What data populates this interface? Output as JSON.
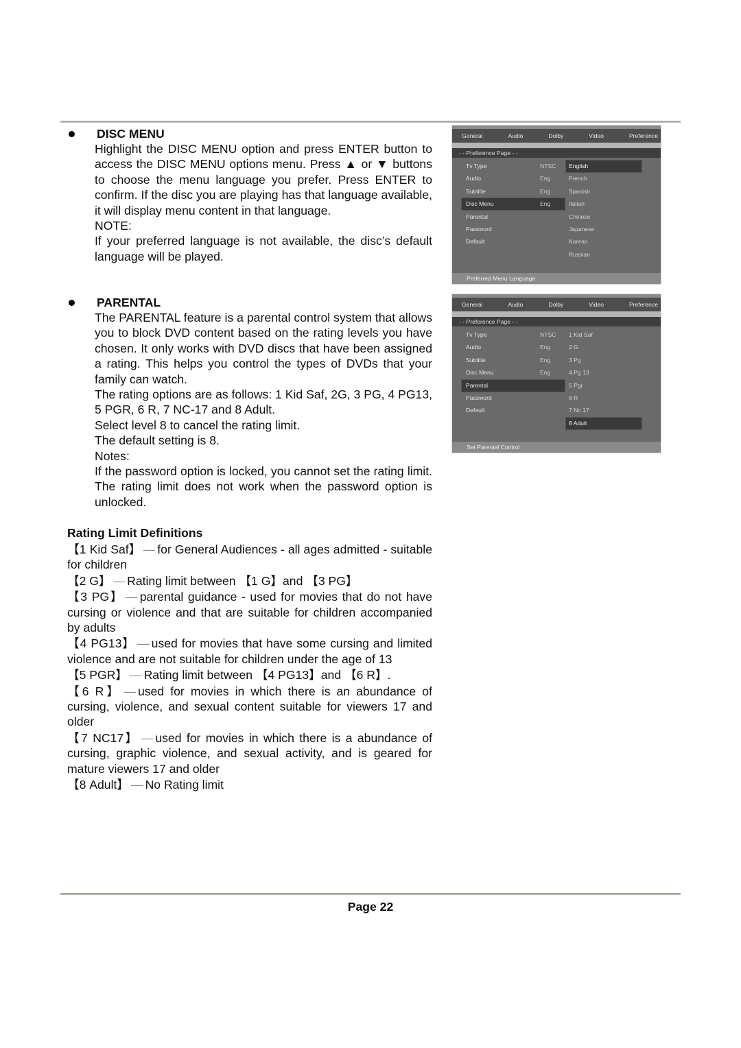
{
  "disc_menu": {
    "heading": "DISC MENU",
    "paragraph": "Highlight the DISC MENU option and press ENTER button to access the DISC MENU options menu. Press ▲ or ▼ buttons to choose the menu language you prefer. Press ENTER to confirm. If the disc you are playing has that language available, it will display menu content in that language.",
    "note_label": "NOTE:",
    "note": "If your preferred language is not available, the disc’s default language will be played."
  },
  "parental": {
    "heading": "PARENTAL",
    "paragraph": "The PARENTAL feature is a parental control system that allows you to block DVD content based on the rating levels you have chosen. It only works with DVD discs that have been assigned a rating. This helps you control the types of DVDs that your family can watch.",
    "options_text": "The rating options are as follows: 1 Kid Saf, 2G, 3 PG, 4 PG13, 5 PGR, 6 R, 7 NC-17 and 8 Adult.",
    "cancel_text": "Select level 8 to cancel the rating limit.",
    "default_text": "The default setting is 8.",
    "notes_label": "Notes:",
    "notes": "If the password option is locked, you cannot set the rating limit. The rating limit does not work when the password option is unlocked."
  },
  "rating_definitions": {
    "heading": "Rating Limit Definitions",
    "items": [
      {
        "tag": "【1 Kid Saf】",
        "text": "for General Audiences - all ages admitted - suitable for children"
      },
      {
        "tag": "【2 G】",
        "text": "Rating limit between 【1 G】and 【3 PG】"
      },
      {
        "tag": "【3 PG】",
        "text": "parental guidance - used for movies that do not have cursing or violence and that are suitable for children accompanied by adults"
      },
      {
        "tag": "【4 PG13】",
        "text": "used for movies that have some cursing and limited violence and are not suitable for children under the age of 13"
      },
      {
        "tag": "【5 PGR】",
        "text": "Rating limit between 【4 PG13】and 【6 R】."
      },
      {
        "tag": "【6 R】",
        "text": "used for movies in which there is an abundance of cursing, violence, and sexual content suitable for viewers 17 and older"
      },
      {
        "tag": "【7 NC17】",
        "text": "used for movies in which there is a abundance of cursing, graphic violence, and sexual activity, and is geared for mature viewers 17 and older"
      },
      {
        "tag": "【8 Adult】",
        "text": "No Rating limit"
      }
    ],
    "separator": "—"
  },
  "osd_common": {
    "tabs": [
      "General",
      "Audio",
      "Dolby",
      "Video",
      "Preference"
    ],
    "page_title": "- -  Preference  Page  - -",
    "rows": [
      {
        "label": "Tv Type",
        "value": "NTSC"
      },
      {
        "label": "Audio",
        "value": "Eng"
      },
      {
        "label": "Subtitle",
        "value": "Eng"
      },
      {
        "label": "Disc Menu",
        "value": "Eng"
      },
      {
        "label": "Parental",
        "value": ""
      },
      {
        "label": "Password",
        "value": ""
      },
      {
        "label": "Default",
        "value": ""
      }
    ]
  },
  "osd_disc_menu": {
    "selected_row": "Disc Menu",
    "options": [
      "English",
      "French",
      "Spanish",
      "Italian",
      "Chinese",
      "Japanese",
      "Korean",
      "Russian"
    ],
    "selected_option": "English",
    "status": "Preferred  Menu  Language"
  },
  "osd_parental": {
    "selected_row": "Parental",
    "options": [
      "1   Kid Saf",
      "2   G",
      "3   Pg",
      "4   Pg   13",
      "5   Pgr",
      "6   R",
      "7   Nc 17",
      "8   Adult"
    ],
    "selected_option": "8   Adult",
    "status": "Set  Parental  Control"
  },
  "footer": {
    "page_label": "Page 22"
  }
}
